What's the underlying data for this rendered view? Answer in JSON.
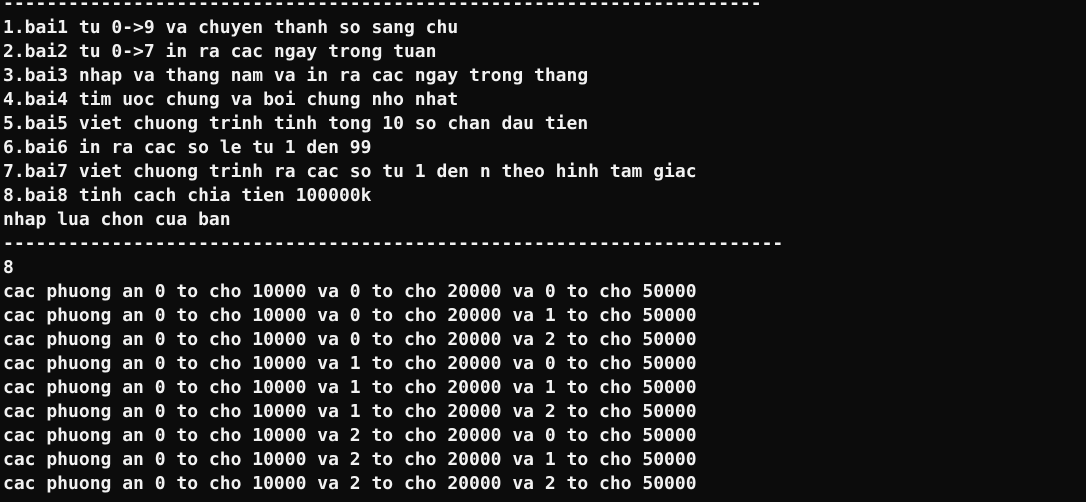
{
  "console": {
    "rule_top": "----------------------------------------------------------------------",
    "menu": [
      "1.bai1 tu 0->9 va chuyen thanh so sang chu",
      "2.bai2 tu 0->7 in ra cac ngay trong tuan",
      "3.bai3 nhap va thang nam va in ra cac ngay trong thang",
      "4.bai4 tim uoc chung va boi chung nho nhat",
      "5.bai5 viet chuong trinh tinh tong 10 so chan dau tien",
      "6.bai6 in ra cac so le tu 1 den 99",
      "7.bai7 viet chuong trinh ra cac so tu 1 den n theo hinh tam giac",
      "8.bai8 tinh cach chia tien 100000k"
    ],
    "prompt": "nhap lua chon cua ban",
    "rule_bottom": "------------------------------------------------------------------------",
    "user_input": "8",
    "output": [
      "cac phuong an 0 to cho 10000 va 0 to cho 20000 va 0 to cho 50000",
      "cac phuong an 0 to cho 10000 va 0 to cho 20000 va 1 to cho 50000",
      "cac phuong an 0 to cho 10000 va 0 to cho 20000 va 2 to cho 50000",
      "cac phuong an 0 to cho 10000 va 1 to cho 20000 va 0 to cho 50000",
      "cac phuong an 0 to cho 10000 va 1 to cho 20000 va 1 to cho 50000",
      "cac phuong an 0 to cho 10000 va 1 to cho 20000 va 2 to cho 50000",
      "cac phuong an 0 to cho 10000 va 2 to cho 20000 va 0 to cho 50000",
      "cac phuong an 0 to cho 10000 va 2 to cho 20000 va 1 to cho 50000",
      "cac phuong an 0 to cho 10000 va 2 to cho 20000 va 2 to cho 50000"
    ]
  }
}
